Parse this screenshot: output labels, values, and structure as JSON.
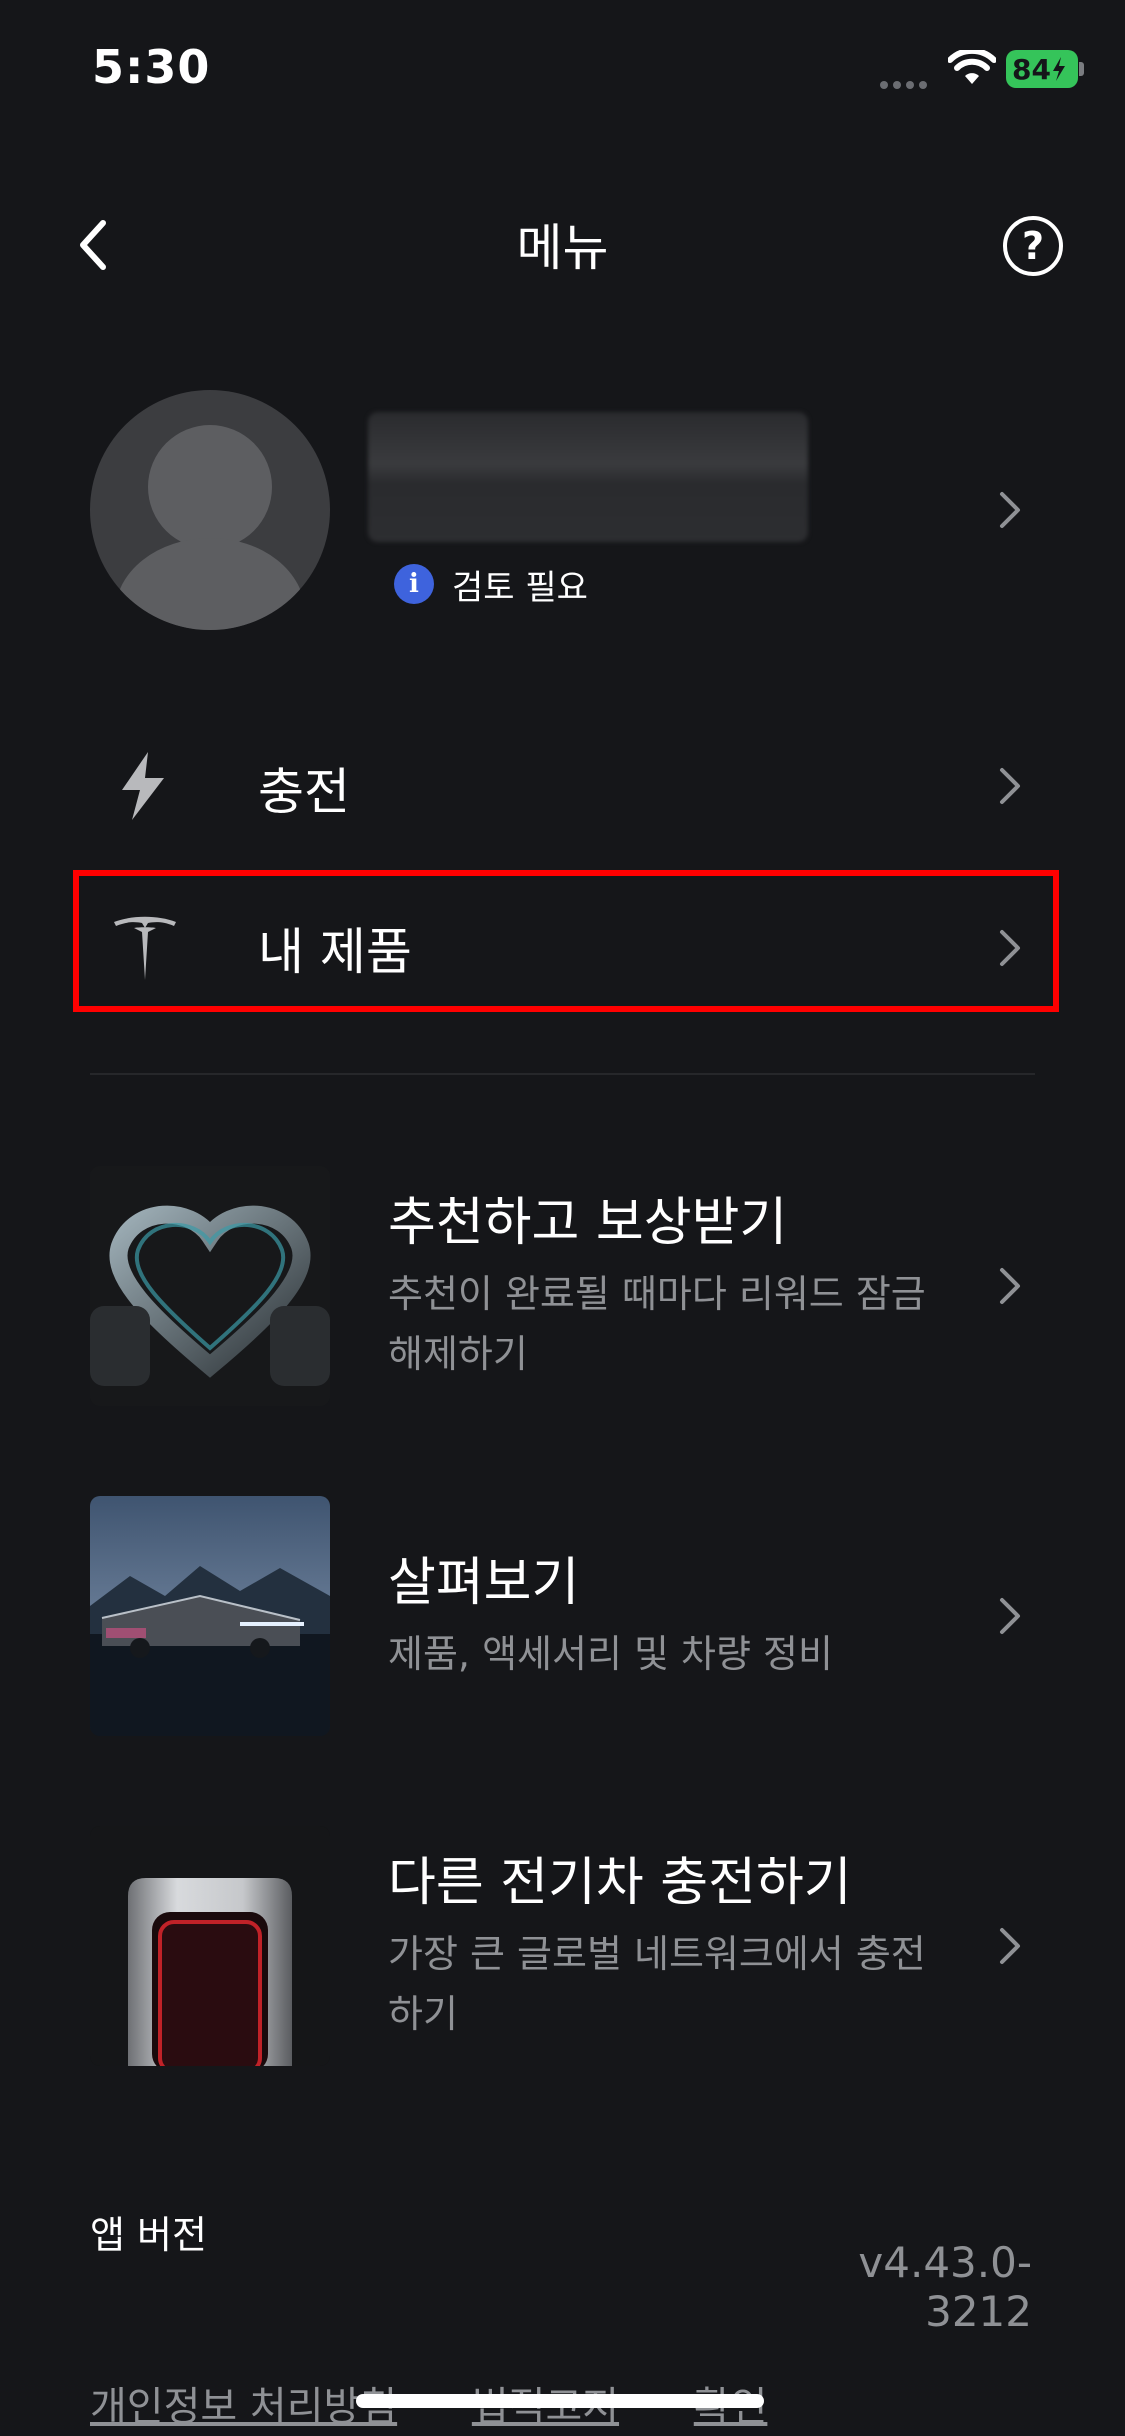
{
  "status_bar": {
    "time": "5:30",
    "battery": "84"
  },
  "header": {
    "title": "메뉴",
    "help_glyph": "?"
  },
  "profile": {
    "review_badge": "i",
    "review_text": "검토 필요"
  },
  "menu_items": [
    {
      "label": "충전",
      "icon": "lightning-icon"
    },
    {
      "label": "내 제품",
      "icon": "tesla-logo-icon"
    }
  ],
  "cards": [
    {
      "title": "추천하고 보상받기",
      "subtitle": "추천이 완료될 때마다 리워드 잠금 해제하기",
      "image": "robot-hands-heart"
    },
    {
      "title": "살펴보기",
      "subtitle": "제품, 액세서리 및 차량 정비",
      "image": "cybertruck"
    },
    {
      "title": "다른 전기차 충전하기",
      "subtitle": "가장 큰 글로벌 네트워크에서 충전하기",
      "image": "tesla-supercharger"
    }
  ],
  "app_version": {
    "label": "앱 버전",
    "value": "v4.43.0-3212"
  },
  "footer": {
    "links": [
      "개인정보 처리방침",
      "법적고지",
      "확인"
    ]
  },
  "colors": {
    "background": "#151619",
    "highlight": "#ff0000",
    "secondary_text": "#8f9195",
    "info_blue": "#3e63dd"
  }
}
